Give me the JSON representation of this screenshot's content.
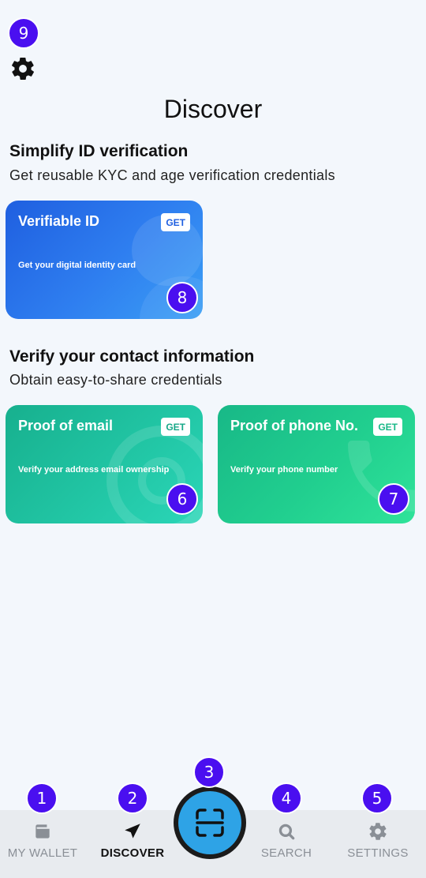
{
  "badges": {
    "b1": "1",
    "b2": "2",
    "b3": "3",
    "b4": "4",
    "b5": "5",
    "b6": "6",
    "b7": "7",
    "b8": "8",
    "b9": "9"
  },
  "header": {
    "title": "Discover"
  },
  "section_id": {
    "title": "Simplify ID verification",
    "subtitle": "Get reusable KYC and age verification credentials"
  },
  "section_contact": {
    "title": "Verify your contact information",
    "subtitle": "Obtain easy-to-share credentials"
  },
  "cards": {
    "verifiable_id": {
      "title": "Verifiable ID",
      "description": "Get your digital identity card",
      "button": "GET"
    },
    "email": {
      "title": "Proof of email",
      "description": "Verify your address email ownership",
      "button": "GET"
    },
    "phone": {
      "title": "Proof of phone No.",
      "description": "Verify your phone number",
      "button": "GET"
    }
  },
  "nav": {
    "wallet": "MY WALLET",
    "discover": "DISCOVER",
    "search": "SEARCH",
    "settings": "SETTINGS"
  },
  "colors": {
    "accent_badge": "#4a0ff0",
    "card_blue": "#2f7ff0",
    "card_teal": "#22c7a6",
    "card_green": "#21cf8f",
    "scan_button": "#2ea3e6"
  },
  "icons": [
    "gear-icon",
    "wallet-icon",
    "discover-icon",
    "scan-icon",
    "search-icon",
    "settings-icon"
  ]
}
